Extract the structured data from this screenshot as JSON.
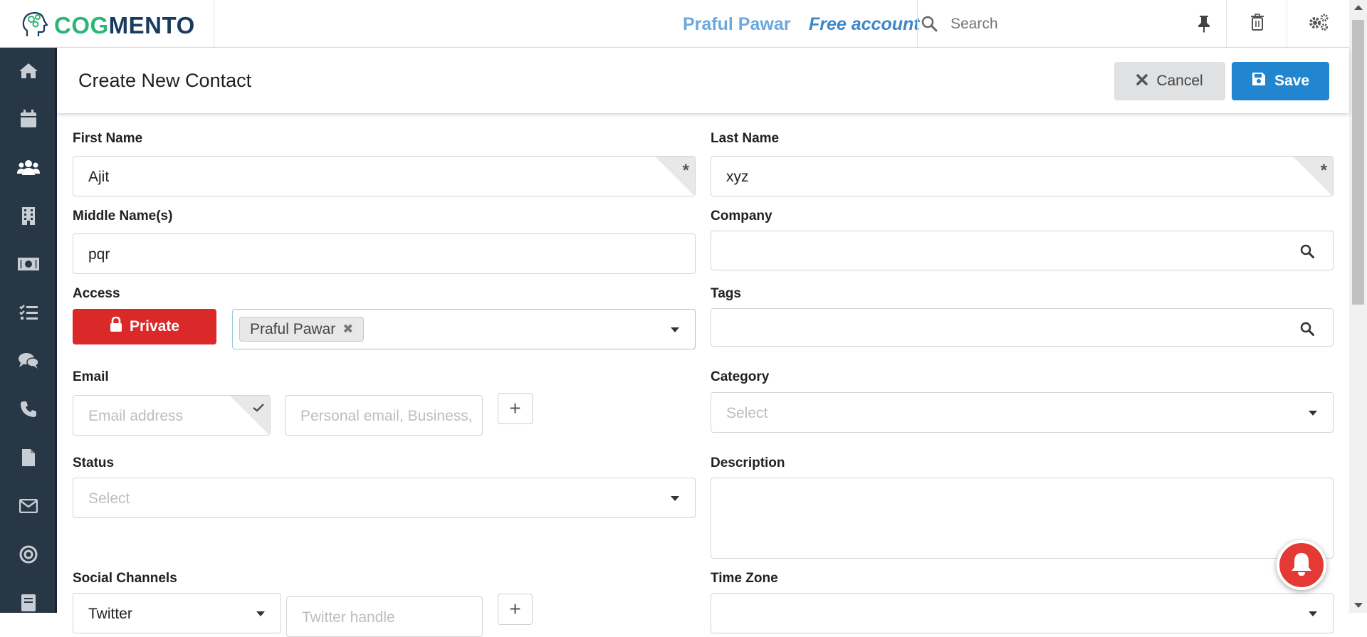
{
  "topbar": {
    "logo_text_a": "COG",
    "logo_text_b": "MENTO",
    "user_name": "Praful Pawar",
    "account_type": "Free account",
    "search_placeholder": "Search"
  },
  "sidebar": {
    "items": [
      {
        "icon": "home-icon"
      },
      {
        "icon": "calendar-icon"
      },
      {
        "icon": "contacts-icon"
      },
      {
        "icon": "companies-icon"
      },
      {
        "icon": "deals-icon"
      },
      {
        "icon": "tasks-icon"
      },
      {
        "icon": "chat-icon"
      },
      {
        "icon": "phone-icon"
      },
      {
        "icon": "documents-icon"
      },
      {
        "icon": "email-icon"
      },
      {
        "icon": "campaigns-icon"
      },
      {
        "icon": "forms-icon"
      }
    ]
  },
  "header": {
    "title": "Create New Contact",
    "cancel_label": "Cancel",
    "save_label": "Save"
  },
  "form": {
    "first_name": {
      "label": "First Name",
      "value": "Ajit",
      "required_mark": "*"
    },
    "last_name": {
      "label": "Last Name",
      "value": "xyz",
      "required_mark": "*"
    },
    "middle_name": {
      "label": "Middle Name(s)",
      "value": "pqr"
    },
    "company": {
      "label": "Company",
      "value": ""
    },
    "access": {
      "label": "Access",
      "private_label": "Private",
      "selected_user": "Praful Pawar",
      "remove_glyph": "✖"
    },
    "tags": {
      "label": "Tags",
      "value": ""
    },
    "email": {
      "label": "Email",
      "address_placeholder": "Email address",
      "type_placeholder": "Personal email, Business,",
      "add_glyph": "+"
    },
    "category": {
      "label": "Category",
      "placeholder": "Select"
    },
    "status": {
      "label": "Status",
      "placeholder": "Select"
    },
    "description": {
      "label": "Description",
      "value": ""
    },
    "social": {
      "label": "Social Channels",
      "channel_value": "Twitter",
      "handle_placeholder": "Twitter handle",
      "add_glyph": "+"
    },
    "timezone": {
      "label": "Time Zone"
    }
  },
  "colors": {
    "sidebar_bg": "#273746",
    "save_blue": "#2185d0",
    "private_red": "#db2828",
    "brand_green": "#2bb673",
    "brand_navy": "#1a3b5d",
    "notif_red": "#e53935"
  }
}
